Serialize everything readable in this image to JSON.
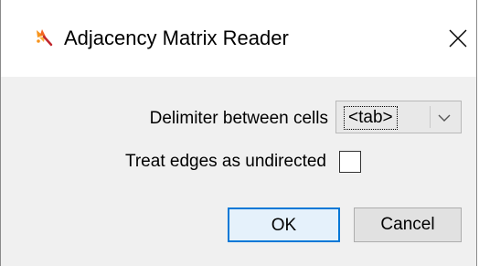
{
  "window": {
    "title": "Adjacency Matrix Reader",
    "app_icon": "cytoscape-app-icon",
    "close_icon": "close-icon"
  },
  "form": {
    "delimiter_label": "Delimiter between cells",
    "delimiter_value": "<tab>",
    "undirected_label": "Treat edges as undirected",
    "undirected_checked": false
  },
  "buttons": {
    "ok_label": "OK",
    "cancel_label": "Cancel"
  },
  "colors": {
    "accent": "#0078d7",
    "dialog_bg": "#f0f0f0"
  }
}
